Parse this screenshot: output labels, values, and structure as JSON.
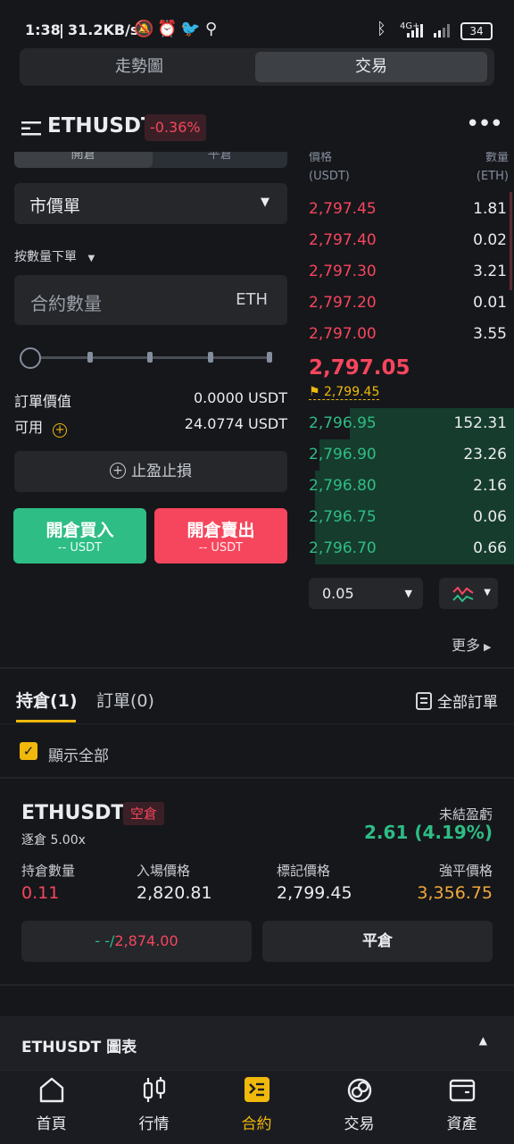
{
  "status": {
    "time": "1:38",
    "net_speed": "31.2KB/s",
    "network": "4G+",
    "battery": "34"
  },
  "top_tabs": [
    "走勢圖",
    "交易"
  ],
  "header": {
    "symbol": "ETHUSDT",
    "change": "-0.36%"
  },
  "trade_tabs": [
    "開倉",
    "平倉"
  ],
  "order_form": {
    "order_type": "市價單",
    "size_mode": "按數量下單",
    "quantity_placeholder": "合約數量",
    "quantity_unit": "ETH",
    "order_value_label": "訂單價值",
    "order_value": "0.0000 USDT",
    "available_label": "可用",
    "available": "24.0774 USDT",
    "tpsl_label": "止盈止損",
    "buy_label": "開倉買入",
    "buy_sub": "-- USDT",
    "sell_label": "開倉賣出",
    "sell_sub": "-- USDT"
  },
  "orderbook": {
    "price_header": "價格",
    "price_unit": "(USDT)",
    "qty_header": "數量",
    "qty_unit": "(ETH)",
    "asks": [
      {
        "price": "2,797.45",
        "qty": "1.81"
      },
      {
        "price": "2,797.40",
        "qty": "0.02"
      },
      {
        "price": "2,797.30",
        "qty": "3.21"
      },
      {
        "price": "2,797.20",
        "qty": "0.01"
      },
      {
        "price": "2,797.00",
        "qty": "3.55"
      }
    ],
    "last_price": "2,797.05",
    "mark_price": "2,799.45",
    "bids": [
      {
        "price": "2,796.95",
        "qty": "152.31"
      },
      {
        "price": "2,796.90",
        "qty": "23.26"
      },
      {
        "price": "2,796.80",
        "qty": "2.16"
      },
      {
        "price": "2,796.75",
        "qty": "0.06"
      },
      {
        "price": "2,796.70",
        "qty": "0.66"
      }
    ],
    "bid_depth_fraction": [
      0.8,
      0.95,
      0.97,
      0.97,
      0.97
    ],
    "precision": "0.05",
    "more": "更多"
  },
  "positions_tabs": {
    "positions": "持倉(1)",
    "orders": "訂單(0)",
    "all_orders": "全部訂單"
  },
  "show_all_label": "顯示全部",
  "position": {
    "symbol": "ETHUSDT",
    "side": "空倉",
    "margin": "逐倉 5.00x",
    "pnl_label": "未結盈虧",
    "pnl": "2.61 (4.19%)",
    "size_label": "持倉數量",
    "size": "0.11",
    "entry_label": "入場價格",
    "entry": "2,820.81",
    "mark_label": "標記價格",
    "mark": "2,799.45",
    "liq_label": "強平價格",
    "liq": "3,356.75",
    "tpsl_dash": "- -/",
    "tpsl_value": "2,874.00",
    "close_label": "平倉"
  },
  "chart_section": {
    "title": "ETHUSDT 圖表"
  },
  "bottom_nav": [
    "首頁",
    "行情",
    "合約",
    "交易",
    "資產"
  ],
  "colors": {
    "red": "#f6465d",
    "green": "#2ebd85",
    "yellow": "#f0b90b",
    "bg": "#16171b"
  }
}
